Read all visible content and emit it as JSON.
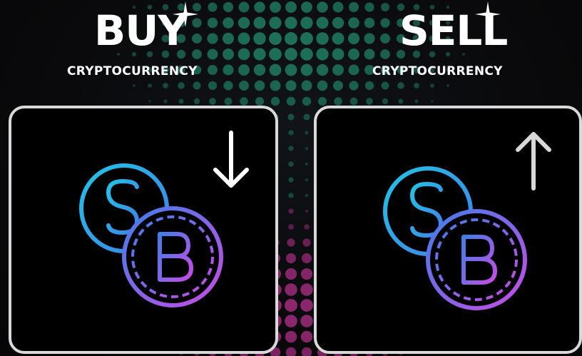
{
  "buy": {
    "title": "BUY",
    "subtitle": "CRYPTOCURRENCY",
    "arrow_icon": "arrow-down-icon",
    "coin_icon": "dollar-bitcoin-coins-icon"
  },
  "sell": {
    "title": "SELL",
    "subtitle": "CRYPTOCURRENCY",
    "arrow_icon": "arrow-up-icon",
    "coin_icon": "dollar-bitcoin-coins-icon"
  },
  "colors": {
    "background": "#0a0a0c",
    "card_border": "#d9d9d9",
    "card_fill": "#000000",
    "icon_cyan": "#22c3e6",
    "icon_blue": "#3f7fe8",
    "icon_magenta": "#c84be6",
    "dots_green": "#1f7a60",
    "dots_magenta": "#9a2a78",
    "arrow_buy": "#ffffff",
    "arrow_sell": "#d8d8d8"
  }
}
